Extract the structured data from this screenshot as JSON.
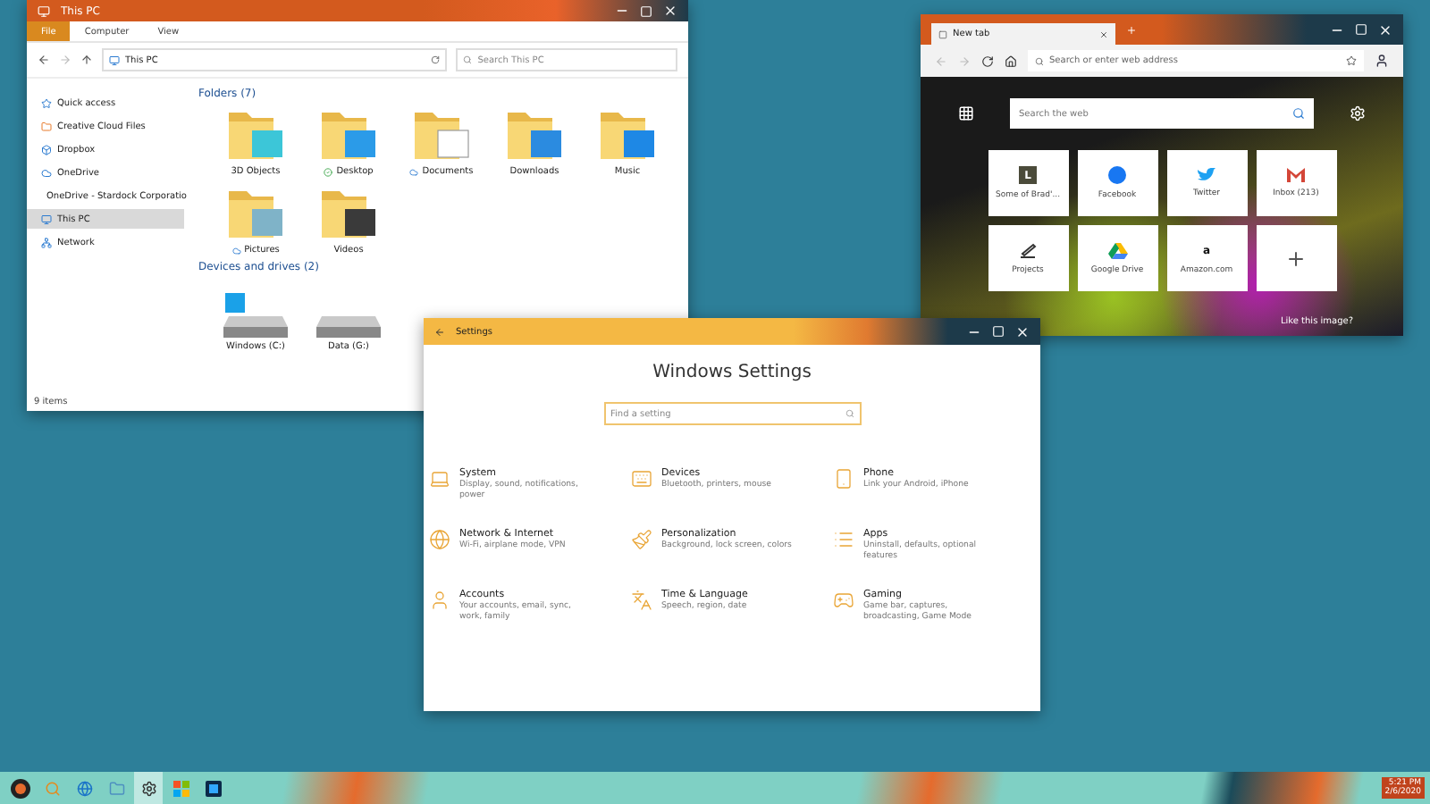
{
  "explorer": {
    "title": "This PC",
    "ribbon_tabs": [
      {
        "label": "File",
        "selected": true
      },
      {
        "label": "Computer",
        "selected": false
      },
      {
        "label": "View",
        "selected": false
      }
    ],
    "address": "This PC",
    "search_placeholder": "Search This PC",
    "sidebar": [
      {
        "label": "Quick access",
        "kind": "star",
        "selected": false
      },
      {
        "label": "Creative Cloud Files",
        "kind": "cloudfiles",
        "selected": false
      },
      {
        "label": "Dropbox",
        "kind": "box",
        "selected": false
      },
      {
        "label": "OneDrive",
        "kind": "cloud",
        "selected": false
      },
      {
        "label": "OneDrive - Stardock Corporatio",
        "kind": "cloud",
        "selected": false
      },
      {
        "label": "This PC",
        "kind": "pc",
        "selected": true
      },
      {
        "label": "Network",
        "kind": "network",
        "selected": false
      }
    ],
    "folders_heading": "Folders (7)",
    "folders": [
      {
        "label": "3D Objects",
        "kind": "cube",
        "synced": false,
        "cloud_only": false
      },
      {
        "label": "Desktop",
        "kind": "desktop",
        "synced": true,
        "cloud_only": false
      },
      {
        "label": "Documents",
        "kind": "document",
        "synced": false,
        "cloud_only": true
      },
      {
        "label": "Downloads",
        "kind": "download",
        "synced": false,
        "cloud_only": false
      },
      {
        "label": "Music",
        "kind": "music",
        "synced": false,
        "cloud_only": false
      },
      {
        "label": "Pictures",
        "kind": "picture",
        "synced": false,
        "cloud_only": true
      },
      {
        "label": "Videos",
        "kind": "video",
        "synced": false,
        "cloud_only": false
      }
    ],
    "drives_heading": "Devices and drives (2)",
    "drives": [
      {
        "label": "Windows (C:)",
        "kind": "system"
      },
      {
        "label": "Data (G:)",
        "kind": "data"
      }
    ],
    "status": "9 items"
  },
  "browser": {
    "tab": "New tab",
    "address_placeholder": "Search or enter web address",
    "search_placeholder": "Search the web",
    "tiles": [
      {
        "label": "Some of Brad'...",
        "kind": "letter",
        "glyph": "L"
      },
      {
        "label": "Facebook",
        "kind": "facebook"
      },
      {
        "label": "Twitter",
        "kind": "twitter"
      },
      {
        "label": "Inbox (213)",
        "kind": "mail"
      },
      {
        "label": "Projects",
        "kind": "projects"
      },
      {
        "label": "Google Drive",
        "kind": "drive"
      },
      {
        "label": "Amazon.com",
        "kind": "letter",
        "glyph": "a"
      },
      {
        "kind": "add"
      }
    ],
    "image_prompt": "Like this image?"
  },
  "settings": {
    "title": "Settings",
    "heading": "Windows Settings",
    "search_placeholder": "Find a setting",
    "categories": [
      {
        "title": "System",
        "description": "Display, sound, notifications, power",
        "kind": "laptop"
      },
      {
        "title": "Devices",
        "description": "Bluetooth, printers, mouse",
        "kind": "keyboard"
      },
      {
        "title": "Phone",
        "description": "Link your Android, iPhone",
        "kind": "phone"
      },
      {
        "title": "Network & Internet",
        "description": "Wi-Fi, airplane mode, VPN",
        "kind": "globe"
      },
      {
        "title": "Personalization",
        "description": "Background, lock screen, colors",
        "kind": "brush"
      },
      {
        "title": "Apps",
        "description": "Uninstall, defaults, optional features",
        "kind": "list"
      },
      {
        "title": "Accounts",
        "description": "Your accounts, email, sync, work, family",
        "kind": "user"
      },
      {
        "title": "Time & Language",
        "description": "Speech, region, date",
        "kind": "language"
      },
      {
        "title": "Gaming",
        "description": "Game bar, captures, broadcasting, Game Mode",
        "kind": "gaming"
      }
    ]
  },
  "taskbar": {
    "apps": [
      {
        "kind": "start",
        "active": false
      },
      {
        "kind": "search",
        "active": false
      },
      {
        "kind": "edge",
        "active": false
      },
      {
        "kind": "explorer",
        "active": false
      },
      {
        "kind": "settings",
        "active": true
      },
      {
        "kind": "store",
        "active": false
      },
      {
        "kind": "photoshop",
        "active": false
      }
    ],
    "time": "5:21 PM",
    "date": "2/6/2020"
  }
}
